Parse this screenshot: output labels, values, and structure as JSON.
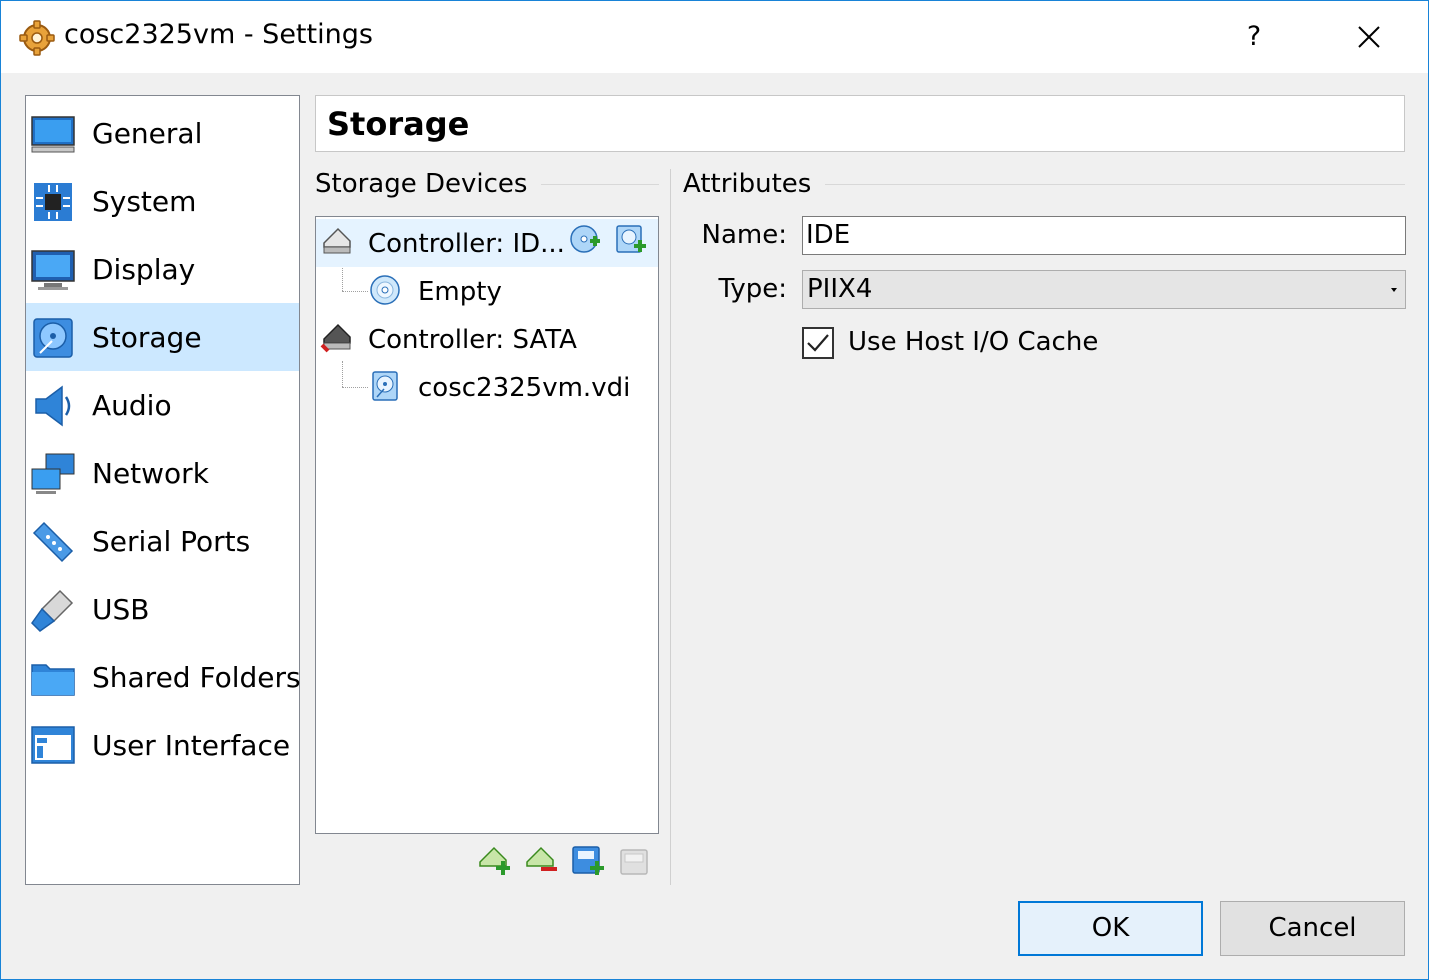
{
  "window": {
    "title": "cosc2325vm - Settings",
    "help_label": "?",
    "accent_color": "#1883d7"
  },
  "categories": [
    {
      "label": "General",
      "icon": "monitor-icon"
    },
    {
      "label": "System",
      "icon": "chip-icon"
    },
    {
      "label": "Display",
      "icon": "display-icon"
    },
    {
      "label": "Storage",
      "icon": "disk-icon",
      "selected": true
    },
    {
      "label": "Audio",
      "icon": "speaker-icon"
    },
    {
      "label": "Network",
      "icon": "network-icon"
    },
    {
      "label": "Serial Ports",
      "icon": "serial-port-icon"
    },
    {
      "label": "USB",
      "icon": "usb-icon"
    },
    {
      "label": "Shared Folders",
      "icon": "folder-icon"
    },
    {
      "label": "User Interface",
      "icon": "window-icon"
    }
  ],
  "page": {
    "title": "Storage"
  },
  "storage_devices": {
    "group_label": "Storage Devices",
    "tree": [
      {
        "label": "Controller: ID...",
        "type": "controller-ide",
        "selected": true
      },
      {
        "label": "Empty",
        "type": "optical-drive"
      },
      {
        "label": "Controller: SATA",
        "type": "controller-sata"
      },
      {
        "label": "cosc2325vm.vdi",
        "type": "hard-disk"
      }
    ]
  },
  "attributes": {
    "group_label": "Attributes",
    "name_label": "Name:",
    "name_value": "IDE",
    "type_label": "Type:",
    "type_value": "PIIX4",
    "cache_label": "Use Host I/O Cache",
    "cache_checked": true
  },
  "buttons": {
    "ok": "OK",
    "cancel": "Cancel"
  }
}
